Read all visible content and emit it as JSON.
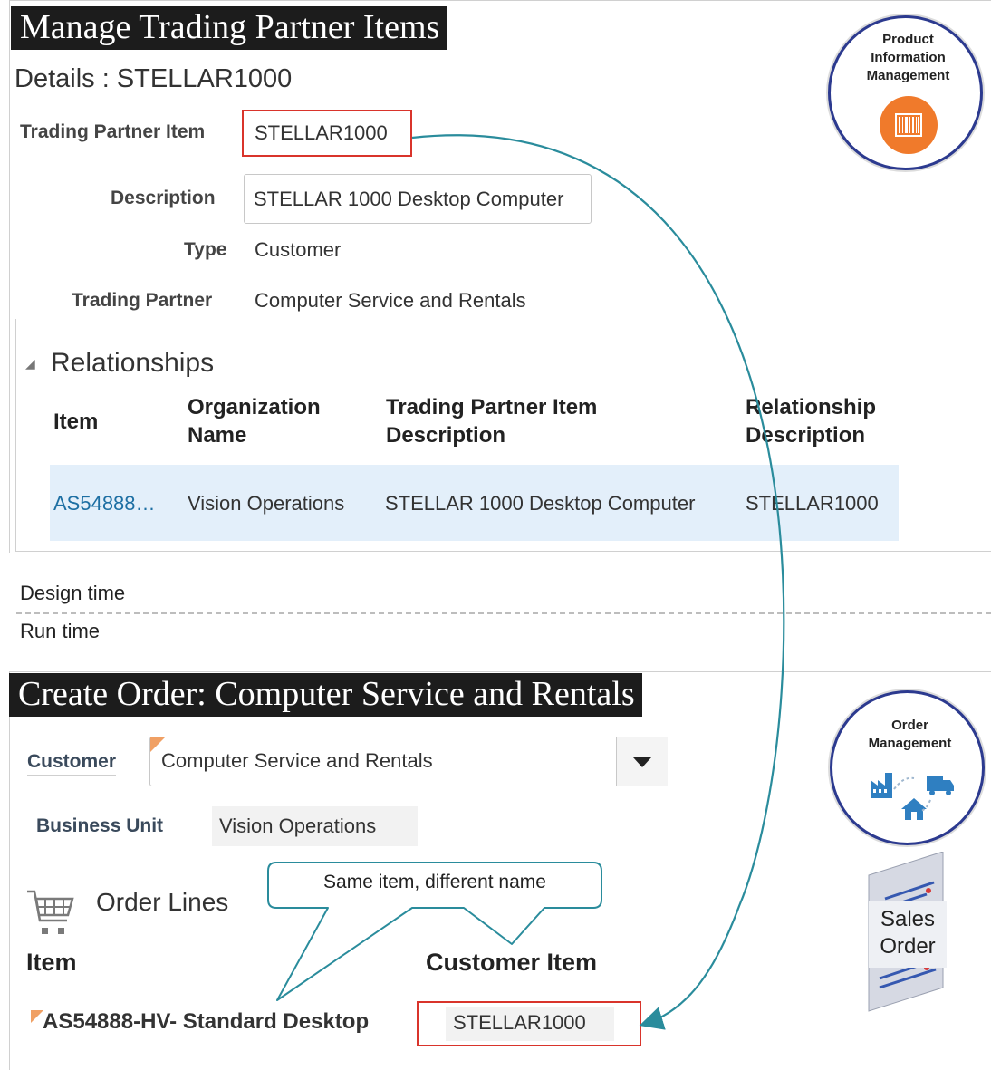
{
  "pim": {
    "banner": "Manage Trading Partner Items",
    "details_title": "Details : STELLAR1000",
    "fields": {
      "trading_partner_item_label": "Trading Partner Item",
      "trading_partner_item_value": "STELLAR1000",
      "description_label": "Description",
      "description_value": "STELLAR 1000 Desktop Computer",
      "type_label": "Type",
      "type_value": "Customer",
      "trading_partner_label": "Trading Partner",
      "trading_partner_value": "Computer Service and Rentals"
    },
    "relationships": {
      "title": "Relationships",
      "columns": [
        "Item",
        "Organization Name",
        "Trading Partner Item Description",
        "Relationship Description"
      ],
      "row": {
        "item": "AS54888…",
        "organization_name": "Vision Operations",
        "tp_item_description": "STELLAR 1000 Desktop Computer",
        "relationship_description": "STELLAR1000"
      }
    },
    "logo": {
      "line1": "Product",
      "line2": "Information",
      "line3": "Management",
      "icon": "barcode-icon"
    }
  },
  "divider": {
    "design_time": "Design time",
    "run_time": "Run time"
  },
  "om": {
    "banner": "Create Order: Computer Service and Rentals",
    "customer_label": "Customer",
    "customer_value": "Computer Service and Rentals",
    "business_unit_label": "Business Unit",
    "business_unit_value": "Vision Operations",
    "order_lines_title": "Order Lines",
    "item_header": "Item",
    "customer_item_header": "Customer Item",
    "item_value": "AS54888-HV- Standard Desktop",
    "customer_item_value": "STELLAR1000",
    "callout": "Same item, different  name",
    "logo": {
      "line1": "Order",
      "line2": "Management",
      "icon": "factory-truck-house-icon"
    },
    "sales_order": {
      "line1": "Sales",
      "line2": "Order"
    }
  },
  "colors": {
    "banner_bg": "#1c1c1c",
    "accent_red": "#d9342b",
    "arrow_teal": "#2a8c9c",
    "link_blue": "#1d6fa3",
    "row_highlight": "#e3effa",
    "logo_orange": "#f07a2b",
    "logo_blue": "#2f7fc1"
  }
}
